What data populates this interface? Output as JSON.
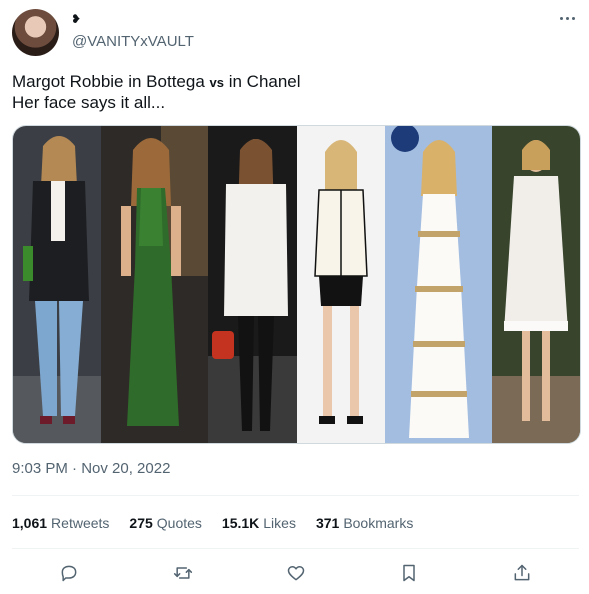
{
  "tweet": {
    "display_name_glyph": "❥",
    "handle": "@VANITYxVAULT",
    "text_line1_before": "Margot Robbie in Bottega ",
    "text_line1_vs": "vs",
    "text_line1_after": " in Chanel",
    "text_line2": "Her face says it all...",
    "timestamp": "9:03 PM · Nov 20, 2022"
  },
  "stats": [
    {
      "count": "1,061",
      "label": "Retweets"
    },
    {
      "count": "275",
      "label": "Quotes"
    },
    {
      "count": "15.1K",
      "label": "Likes"
    },
    {
      "count": "371",
      "label": "Bookmarks"
    }
  ],
  "actions": [
    "reply-icon",
    "retweet-icon",
    "like-icon",
    "bookmark-icon",
    "share-icon"
  ],
  "colors": {
    "text": "#0f1419",
    "secondary": "#536471",
    "border": "#cfd9de",
    "divider": "#eff3f4"
  }
}
